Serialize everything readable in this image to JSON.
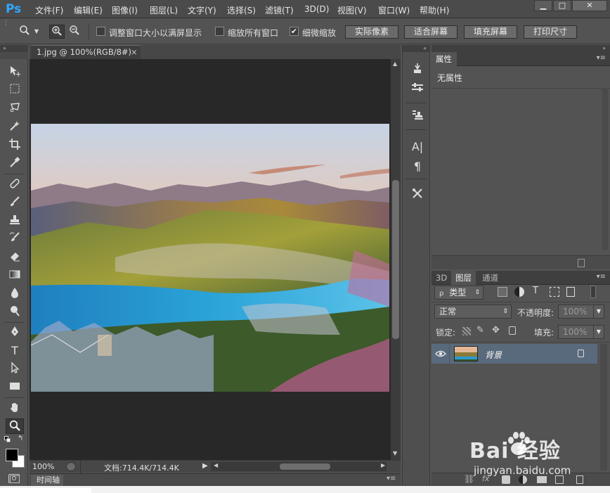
{
  "app": {
    "logo": "Ps"
  },
  "menu": {
    "items": [
      "文件(F)",
      "编辑(E)",
      "图像(I)",
      "图层(L)",
      "文字(Y)",
      "选择(S)",
      "滤镜(T)",
      "3D(D)",
      "视图(V)",
      "窗口(W)",
      "帮助(H)"
    ]
  },
  "window_controls": {
    "minimize": "▁",
    "maximize": "□",
    "close": "✕"
  },
  "options_bar": {
    "resize_windows_label": "调整窗口大小以满屏显示",
    "resize_windows_checked": false,
    "zoom_all_label": "缩放所有窗口",
    "zoom_all_checked": false,
    "scrubby_label": "细微缩放",
    "scrubby_checked": true,
    "actual_pixels": "实际像素",
    "fit_screen": "适合屏幕",
    "fill_screen": "填充屏幕",
    "print_size": "打印尺寸"
  },
  "document": {
    "tab_title": "1.jpg @ 100%(RGB/8#)",
    "tab_close": "×",
    "zoom": "100%",
    "doc_info": "文档:714.4K/714.4K",
    "timeline_label": "时间轴"
  },
  "properties_panel": {
    "title": "属性",
    "content": "无属性"
  },
  "layers_panel": {
    "tabs": [
      "3D",
      "图层",
      "通道"
    ],
    "active_tab": "图层",
    "filter_kind": "类型",
    "blend_mode": "正常",
    "opacity_label": "不透明度:",
    "opacity_value": "100%",
    "lock_label": "锁定:",
    "fill_label": "填充:",
    "fill_value": "100%",
    "layers": [
      {
        "name": "背景",
        "visible": true,
        "locked": true
      }
    ]
  },
  "watermark": {
    "brand": "Bai 经验",
    "url": "jingyan.baidu.com"
  },
  "colors": {
    "accent": "#31a8ff",
    "canvas_bg": "#282828",
    "panel_bg": "#535353",
    "selected_layer": "#596a7c"
  }
}
